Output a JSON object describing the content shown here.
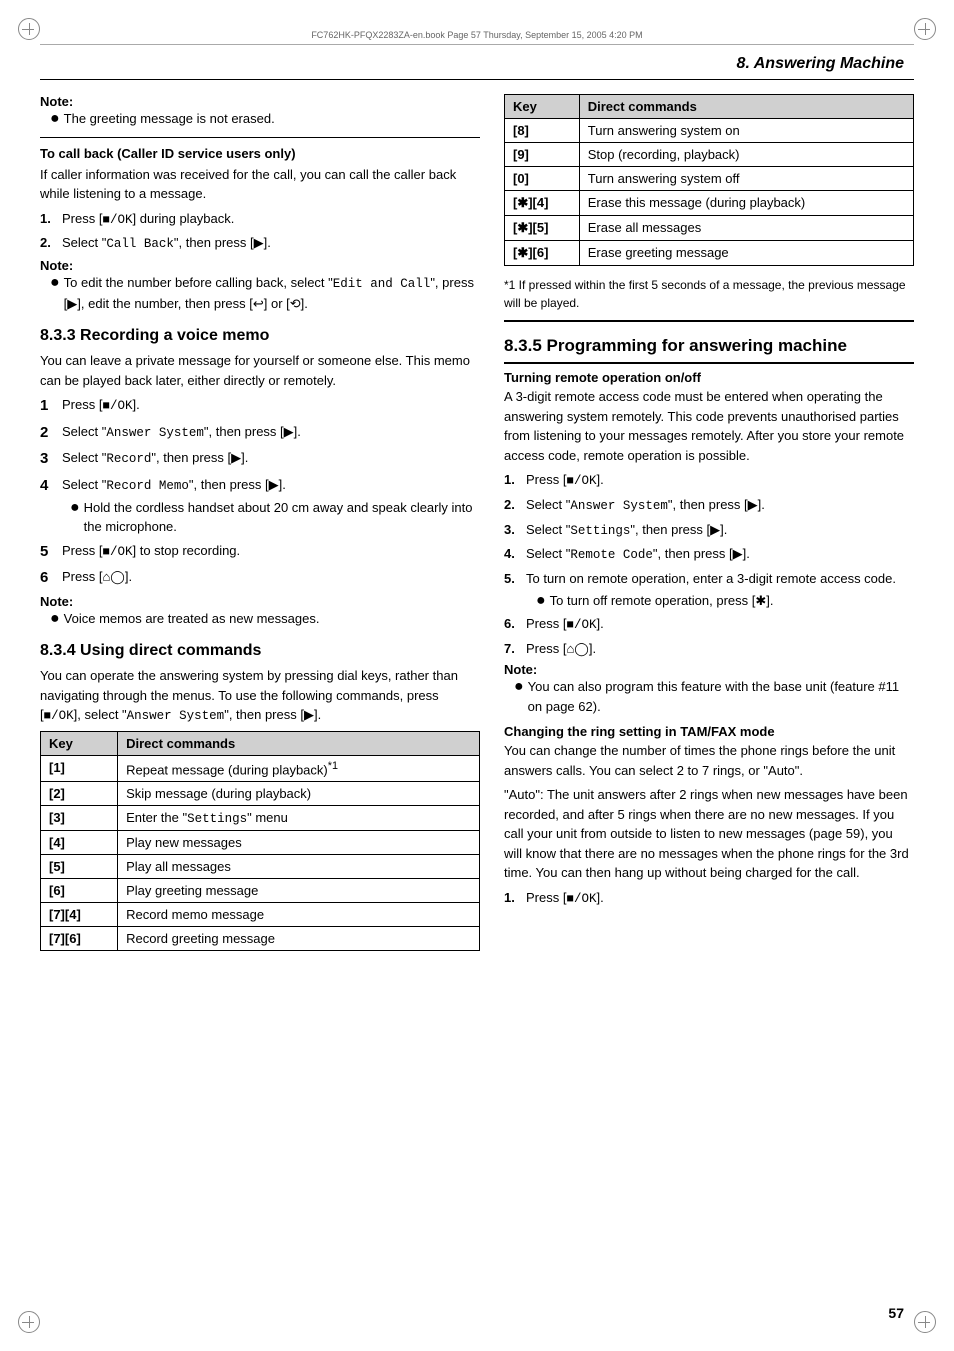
{
  "page": {
    "file_info": "FC762HK-PFQX2283ZA-en.book  Page 57  Thursday, September 15, 2005  4:20 PM",
    "header_title": "8. Answering Machine",
    "page_number": "57"
  },
  "left_col": {
    "note_top": {
      "label": "Note:",
      "items": [
        "The greeting message is not erased."
      ]
    },
    "callout": "To call back (Caller ID service users only)",
    "callout_body": "If caller information was received for the call, you can call the caller back while listening to a message.",
    "steps_callback": [
      {
        "num": "1.",
        "text": "Press [",
        "mono1": "■/OK",
        "text2": "] during playback."
      },
      {
        "num": "2.",
        "text": "Select \"",
        "mono1": "Call Back",
        "text2": "\", then press [",
        "mono2": "▶",
        "text3": "]."
      }
    ],
    "note_callback": {
      "label": "Note:",
      "items": [
        "To edit the number before calling back, select \"Edit and Call\", press [▶], edit the number, then press [↩] or [⟲]."
      ]
    },
    "section_833": "8.3.3 Recording a voice memo",
    "section_833_body": "You can leave a private message for yourself or someone else. This memo can be played back later, either directly or remotely.",
    "steps_833": [
      {
        "num": "1",
        "text": "Press [",
        "mono": "■/OK",
        "text2": "]."
      },
      {
        "num": "2",
        "text": "Select \"",
        "mono": "Answer System",
        "text2": "\", then press [▶]."
      },
      {
        "num": "3",
        "text": "Select \"",
        "mono": "Record",
        "text2": "\", then press [▶]."
      },
      {
        "num": "4",
        "text": "Select \"",
        "mono": "Record Memo",
        "text2": "\", then press [▶].",
        "sub_bullet": "Hold the cordless handset about 20 cm away and speak clearly into the microphone."
      },
      {
        "num": "5",
        "text": "Press [",
        "mono": "■/OK",
        "text2": "] to stop recording."
      },
      {
        "num": "6",
        "text": "Press [",
        "mono": "⌂◯",
        "text2": "]."
      }
    ],
    "note_833": {
      "label": "Note:",
      "items": [
        "Voice memos are treated as new messages."
      ]
    },
    "section_834": "8.3.4 Using direct commands",
    "section_834_body": "You can operate the answering system by pressing dial keys, rather than navigating through the menus. To use the following commands, press [",
    "section_834_mono": "■/OK",
    "section_834_body2": "], select \"",
    "section_834_mono2": "Answer System",
    "section_834_body3": "\", then press [▶].",
    "table1": {
      "headers": [
        "Key",
        "Direct commands"
      ],
      "rows": [
        {
          "key": "[1]",
          "command": "Repeat message (during playback)*1"
        },
        {
          "key": "[2]",
          "command": "Skip message (during playback)"
        },
        {
          "key": "[3]",
          "command": "Enter the \"Settings\" menu"
        },
        {
          "key": "[4]",
          "command": "Play new messages"
        },
        {
          "key": "[5]",
          "command": "Play all messages"
        },
        {
          "key": "[6]",
          "command": "Play greeting message"
        },
        {
          "key": "[7][4]",
          "command": "Record memo message"
        },
        {
          "key": "[7][6]",
          "command": "Record greeting message"
        }
      ]
    }
  },
  "right_col": {
    "table2": {
      "headers": [
        "Key",
        "Direct commands"
      ],
      "rows": [
        {
          "key": "[8]",
          "command": "Turn answering system on"
        },
        {
          "key": "[9]",
          "command": "Stop (recording, playback)"
        },
        {
          "key": "[0]",
          "command": "Turn answering system off"
        },
        {
          "key": "[✱][4]",
          "command": "Erase this message (during playback)"
        },
        {
          "key": "[✱][5]",
          "command": "Erase all messages"
        },
        {
          "key": "[✱][6]",
          "command": "Erase greeting message"
        }
      ]
    },
    "footnote": "*1  If pressed within the first 5 seconds of a message, the previous message will be played.",
    "section_835": "8.3.5 Programming for answering machine",
    "turning_heading": "Turning remote operation on/off",
    "turning_body": "A 3-digit remote access code must be entered when operating the answering system remotely. This code prevents unauthorised parties from listening to your messages remotely. After you store your remote access code, remote operation is possible.",
    "steps_835": [
      {
        "num": "1.",
        "text": "Press [",
        "mono": "■/OK",
        "text2": "]."
      },
      {
        "num": "2.",
        "text": "Select \"",
        "mono": "Answer System",
        "text2": "\", then press [▶]."
      },
      {
        "num": "3.",
        "text": "Select \"",
        "mono": "Settings",
        "text2": "\", then press [▶]."
      },
      {
        "num": "4.",
        "text": "Select \"",
        "mono": "Remote Code",
        "text2": "\", then press [▶]."
      },
      {
        "num": "5.",
        "text": "To turn on remote operation, enter a 3-digit remote access code.",
        "sub_bullet": "To turn off remote operation, press [✱]."
      },
      {
        "num": "6.",
        "text": "Press [",
        "mono": "■/OK",
        "text2": "]."
      },
      {
        "num": "7.",
        "text": "Press [",
        "mono": "⌂◯",
        "text2": "]."
      }
    ],
    "note_835": {
      "label": "Note:",
      "items": [
        "You can also program this feature with the base unit (feature #11 on page 62)."
      ]
    },
    "ring_heading": "Changing the ring setting in TAM/FAX mode",
    "ring_body1": "You can change the number of times the phone rings before the unit answers calls. You can select 2 to 7 rings, or \"Auto\".",
    "ring_body2": "\"Auto\": The unit answers after 2 rings when new messages have been recorded, and after 5 rings when there are no new messages. If you call your unit from outside to listen to new messages (page 59), you will know that there are no messages when the phone rings for the 3rd time. You can then hang up without being charged for the call.",
    "ring_step1": {
      "num": "1.",
      "text": "Press [",
      "mono": "■/OK",
      "text2": "]."
    }
  }
}
